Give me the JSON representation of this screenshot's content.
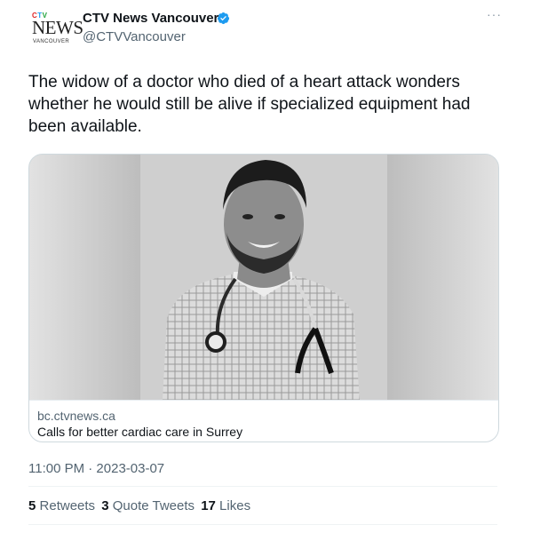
{
  "account": {
    "display_name": "CTV News Vancouver",
    "handle": "@CTVVancouver",
    "avatar_logo": {
      "top": "CTV",
      "main": "NEWS",
      "sub": "VANCOUVER"
    },
    "verified_icon": "verified-badge-icon",
    "verified_color": "#1d9bf0"
  },
  "more_icon": "more-dots-icon",
  "tweet": {
    "text": "The widow of a doctor who died of a heart attack wonders whether he would still be alive if specialized equipment had been available."
  },
  "link_card": {
    "domain": "bc.ctvnews.ca",
    "title": "Calls for better cardiac care in Surrey",
    "image": "black-and-white portrait of smiling man with stethoscope"
  },
  "timestamp": "11:00 PM · 2023-03-07",
  "stats": {
    "retweets_count": "5",
    "retweets_label": "Retweets",
    "quotes_count": "3",
    "quotes_label": "Quote Tweets",
    "likes_count": "17",
    "likes_label": "Likes"
  }
}
